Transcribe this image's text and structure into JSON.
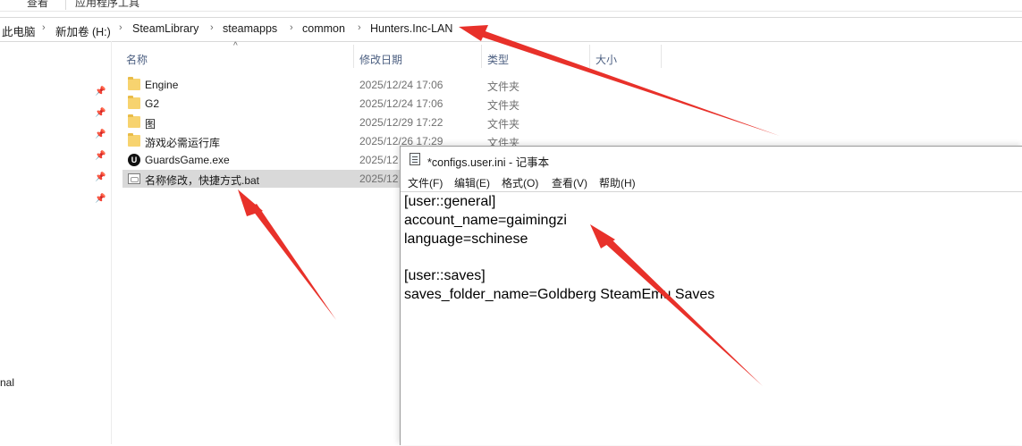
{
  "ribbon": {
    "tabs": [
      "查看",
      "应用程序工具"
    ]
  },
  "breadcrumb": [
    "此电脑",
    "新加卷 (H:)",
    "SteamLibrary",
    "steamapps",
    "common",
    "Hunters.Inc-LAN"
  ],
  "navigation": {
    "partial_label": "nal"
  },
  "columns": {
    "name": "名称",
    "date": "修改日期",
    "type": "类型",
    "size": "大小"
  },
  "files": [
    {
      "name": "Engine",
      "date": "2025/12/24 17:06",
      "type": "文件夹",
      "icon": "folder-icon"
    },
    {
      "name": "G2",
      "date": "2025/12/24 17:06",
      "type": "文件夹",
      "icon": "folder-icon"
    },
    {
      "name": "图",
      "date": "2025/12/29 17:22",
      "type": "文件夹",
      "icon": "folder-icon"
    },
    {
      "name": "游戏必需运行库",
      "date": "2025/12/26 17:29",
      "type": "文件夹",
      "icon": "folder-icon"
    },
    {
      "name": "GuardsGame.exe",
      "date": "2025/12",
      "type": "",
      "icon": "unreal-engine-icon"
    },
    {
      "name": "名称修改，快捷方式.bat",
      "date": "2025/12",
      "type": "",
      "icon": "batch-file-icon"
    }
  ],
  "notepad": {
    "title": "*configs.user.ini - 记事本",
    "menu": [
      "文件(F)",
      "编辑(E)",
      "格式(O)",
      "查看(V)",
      "帮助(H)"
    ],
    "lines": [
      "[user::general]",
      "account_name=gaimingzi",
      "language=schinese",
      "",
      "[user::saves]",
      "saves_folder_name=Goldberg SteamEmu Saves"
    ]
  },
  "colors": {
    "arrow": "#e8312a",
    "selected_row": "#d9d9d9",
    "folder": "#f7d36f",
    "header_text": "#4d6082"
  }
}
